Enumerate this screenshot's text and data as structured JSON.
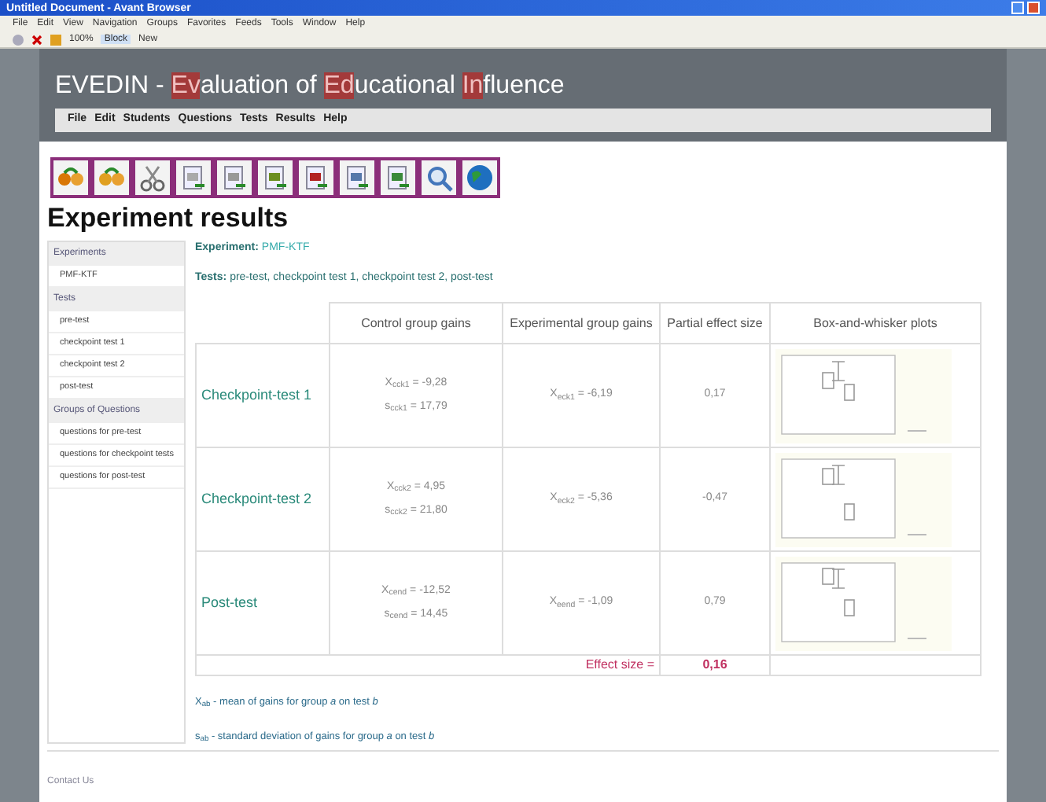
{
  "window": {
    "title": "Untitled Document - Avant Browser"
  },
  "browser_menu": [
    "File",
    "Edit",
    "View",
    "Navigation",
    "Groups",
    "Favorites",
    "Feeds",
    "Tools",
    "Window",
    "Help"
  ],
  "browser_toolbar": {
    "zoom": "100%",
    "block": "Block",
    "new": "New"
  },
  "site_title": [
    {
      "text": "EVEDIN - ",
      "highlight": false
    },
    {
      "text": "Ev",
      "highlight": true
    },
    {
      "text": "aluation of ",
      "highlight": false
    },
    {
      "text": "Ed",
      "highlight": true
    },
    {
      "text": "ucational ",
      "highlight": false
    },
    {
      "text": "In",
      "highlight": true
    },
    {
      "text": "fluence",
      "highlight": false
    }
  ],
  "site_menu": [
    "File",
    "Edit",
    "Students",
    "Questions",
    "Tests",
    "Results",
    "Help"
  ],
  "page_title": "Experiment results",
  "sidebar": [
    {
      "heading": "Experiments",
      "items": [
        "PMF-KTF"
      ]
    },
    {
      "heading": "Tests",
      "items": [
        "pre-test",
        "checkpoint test 1",
        "checkpoint test 2",
        "post-test"
      ]
    },
    {
      "heading": "Groups of Questions",
      "items": [
        "questions for pre-test",
        "questions for checkpoint tests",
        "questions for post-test"
      ]
    }
  ],
  "experiment": {
    "label": "Experiment:",
    "value": "PMF-KTF"
  },
  "tests": {
    "label": "Tests:",
    "value": "pre-test, checkpoint test 1, checkpoint test 2, post-test"
  },
  "table": {
    "columns": [
      "Control group gains",
      "Experimental group gains",
      "Partial effect size",
      "Box-and-whisker plots"
    ],
    "rows": [
      {
        "name": "Checkpoint-test 1",
        "control": [
          "X$_{cck1}$ = -9,28",
          "s$_{cck1}$ = 17,79"
        ],
        "experimental": "X$_{eck1}$ = -6,19",
        "partial": "0,17"
      },
      {
        "name": "Checkpoint-test 2",
        "control": [
          "X$_{cck2}$ = 4,95",
          "s$_{cck2}$ = 21,80"
        ],
        "experimental": "X$_{eck2}$ = -5,36",
        "partial": "-0,47"
      },
      {
        "name": "Post-test",
        "control": [
          "X$_{cend}$ = -12,52",
          "s$_{cend}$ = 14,45"
        ],
        "experimental": "X$_{eend}$ = -1,09",
        "partial": "0,79"
      }
    ],
    "effect_label": "Effect size =",
    "effect_value": "0,16"
  },
  "legend": [
    "X$_{ab}$ - mean of gains for group *a* on test *b*",
    "s$_{ab}$ - standard deviation of gains for group *a* on test *b*"
  ],
  "footer": "Contact Us"
}
